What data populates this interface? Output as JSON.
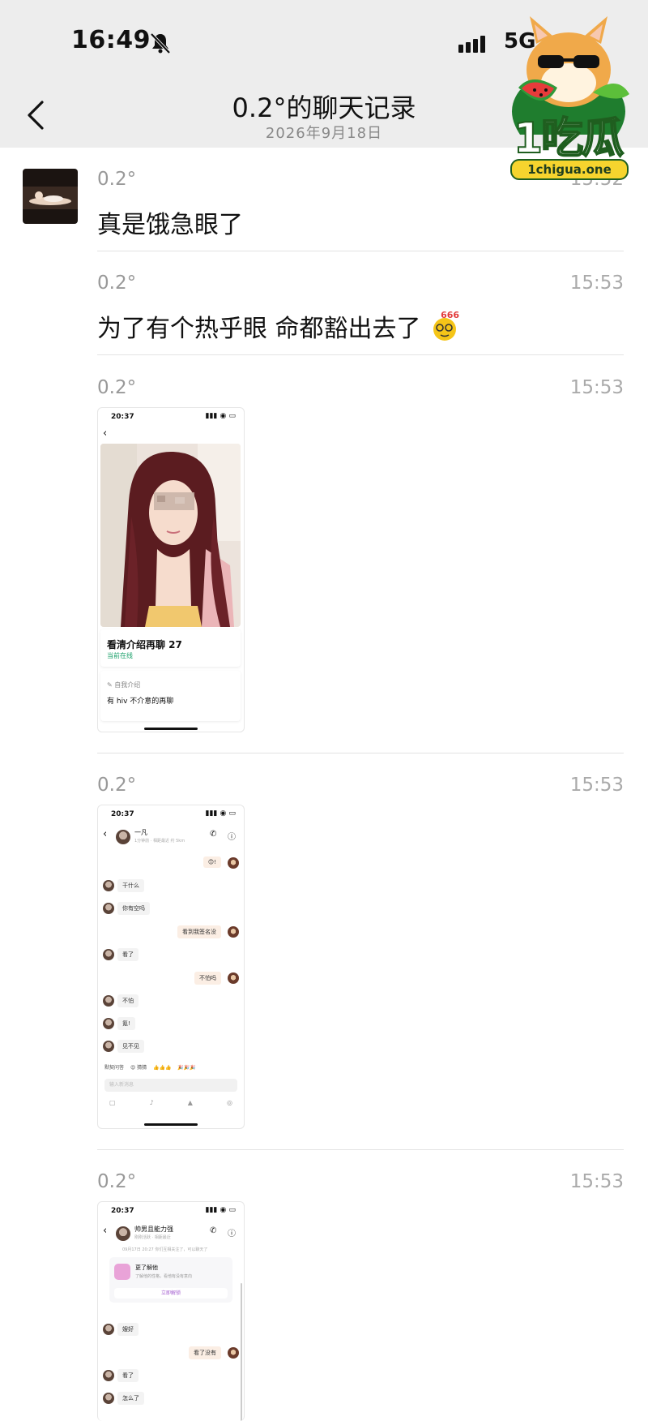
{
  "status_bar": {
    "time": "16:49",
    "network": "5G",
    "icons": [
      "bell-off-icon",
      "signal-icon"
    ]
  },
  "header": {
    "title": "0.2°的聊天记录",
    "subtitle": "2026年9月18日"
  },
  "watermark": {
    "logo_text": "1吃瓜",
    "url": "1chigua.one"
  },
  "messages": [
    {
      "sender": "0.2°",
      "time": "15:52",
      "text": "真是饿急眼了"
    },
    {
      "sender": "0.2°",
      "time": "15:53",
      "text": "为了有个热乎眼 命都豁出去了",
      "emoji": "666"
    },
    {
      "sender": "0.2°",
      "time": "15:53",
      "type": "image",
      "screenshot": {
        "time": "20:37",
        "name_line": "看清介绍再聊 27",
        "status": "当前在线",
        "intro_label": "自我介绍",
        "intro_text": "有 hiv 不介意的再聊"
      }
    },
    {
      "sender": "0.2°",
      "time": "15:53",
      "type": "image",
      "screenshot": {
        "time": "20:37",
        "contact": "一凡",
        "contact_sub": "1分钟前 · 相距最近 约 5km",
        "chat": [
          {
            "side": "right",
            "text": "😊!"
          },
          {
            "side": "left",
            "text": "干什么"
          },
          {
            "side": "left",
            "text": "你有空吗"
          },
          {
            "side": "right",
            "text": "看到我签名没"
          },
          {
            "side": "left",
            "text": "看了"
          },
          {
            "side": "right",
            "text": "不怕吗"
          },
          {
            "side": "left",
            "text": "不怕"
          },
          {
            "side": "left",
            "text": "氪!"
          },
          {
            "side": "left",
            "text": "见不见"
          }
        ],
        "quick_replies": [
          "默契问答",
          "😍 猜猜",
          "👍👍👍",
          "🎉🎉🎉"
        ],
        "input_placeholder": "输入新消息"
      }
    },
    {
      "sender": "0.2°",
      "time": "15:53",
      "type": "image",
      "screenshot": {
        "time": "20:37",
        "contact": "帅男且能力强",
        "contact_sub": "刚刚活跃 · 相距最近",
        "notice": "09月17日 20:27 你们互相关注了，可以聊天了",
        "card_title": "更了解他",
        "card_sub": "了解他的性格，看他有没有意向",
        "card_button": "立即解锁",
        "chat": [
          {
            "side": "left",
            "text": "嫂好"
          },
          {
            "side": "right",
            "text": "看了没有"
          },
          {
            "side": "left",
            "text": "看了"
          },
          {
            "side": "left",
            "text": "怎么了"
          }
        ]
      }
    }
  ]
}
